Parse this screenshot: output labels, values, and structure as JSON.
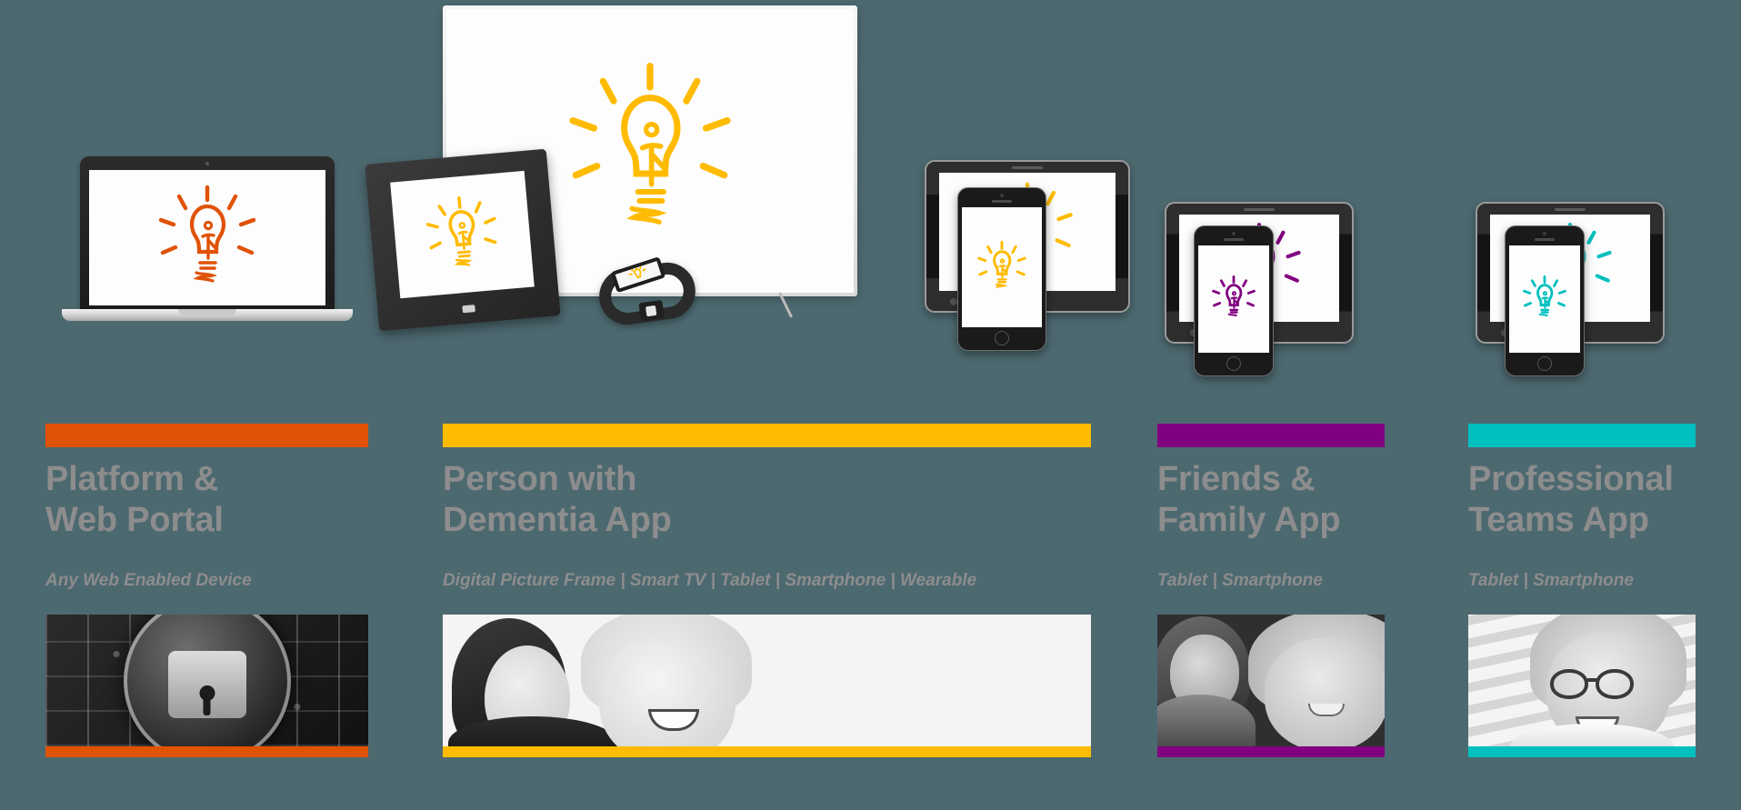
{
  "page": {
    "background_color": "#4d6970",
    "title_color": "#8d8d8d"
  },
  "columns": [
    {
      "id": "platform-web-portal",
      "accent_color": "#e05206",
      "title_line1": "Platform &",
      "title_line2": "Web Portal",
      "subtitle": "Any Web Enabled Device",
      "devices": [
        "laptop"
      ],
      "photo_caption": "padlock-circuit-board-security-photo",
      "bulb_color": "#e05206"
    },
    {
      "id": "person-with-dementia-app",
      "accent_color": "#ffbb00",
      "title_line1": "Person with",
      "title_line2": "Dementia App",
      "subtitle": "Digital Picture Frame | Smart TV | Tablet | Smartphone | Wearable",
      "devices": [
        "smart-tv",
        "digital-picture-frame",
        "wearable-band",
        "tablet",
        "smartphone"
      ],
      "photo_caption": "two-women-smiling-photo",
      "bulb_color": "#ffbb00"
    },
    {
      "id": "friends-family-app",
      "accent_color": "#800080",
      "title_line1": "Friends &",
      "title_line2": "Family App",
      "subtitle": "Tablet | Smartphone",
      "devices": [
        "tablet",
        "smartphone"
      ],
      "photo_caption": "girl-and-older-woman-photo",
      "bulb_color": "#800080"
    },
    {
      "id": "professional-teams-app",
      "accent_color": "#00bfbf",
      "title_line1": "Professional",
      "title_line2": "Teams App",
      "subtitle": "Tablet | Smartphone",
      "devices": [
        "tablet",
        "smartphone"
      ],
      "photo_caption": "smiling-nurse-with-glasses-photo",
      "bulb_color": "#00bfbf"
    }
  ]
}
